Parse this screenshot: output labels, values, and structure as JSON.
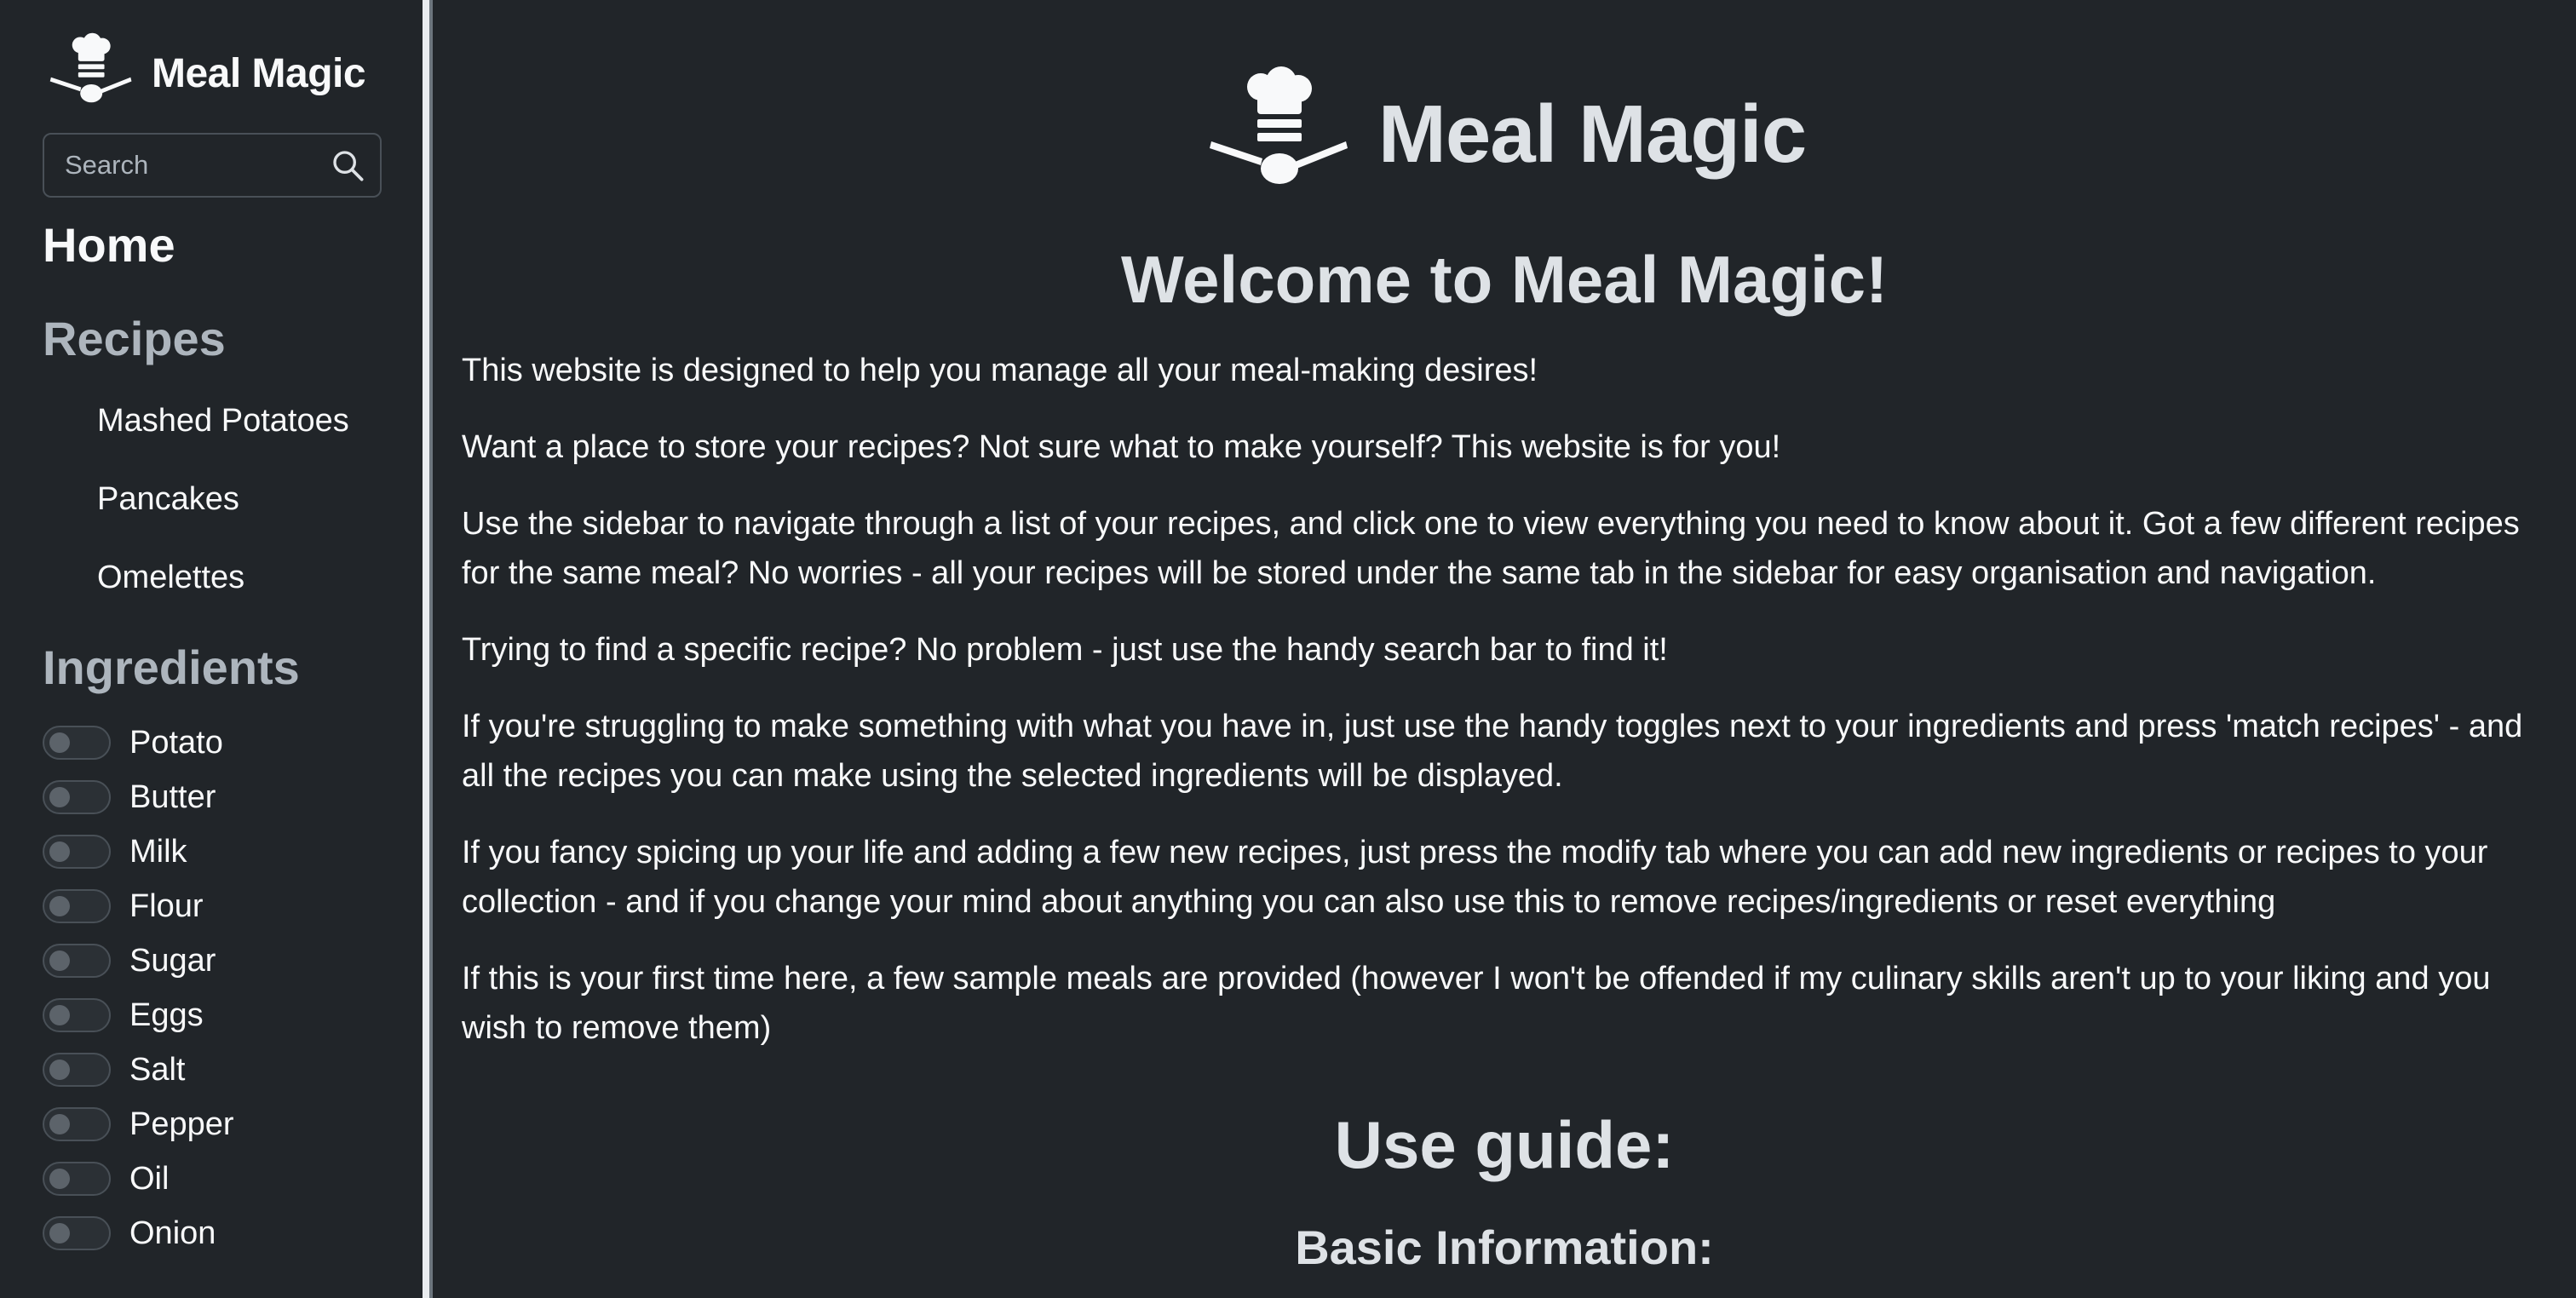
{
  "brand": {
    "name": "Meal Magic"
  },
  "search": {
    "placeholder": "Search"
  },
  "nav": {
    "home": "Home",
    "recipes_heading": "Recipes",
    "recipes": [
      "Mashed Potatoes",
      "Pancakes",
      "Omelettes"
    ],
    "ingredients_heading": "Ingredients",
    "ingredients": [
      "Potato",
      "Butter",
      "Milk",
      "Flour",
      "Sugar",
      "Eggs",
      "Salt",
      "Pepper",
      "Oil",
      "Onion"
    ]
  },
  "main": {
    "hero_name": "Meal Magic",
    "welcome": "Welcome to Meal Magic!",
    "paragraphs": [
      "This website is designed to help you manage all your meal-making desires!",
      "Want a place to store your recipes? Not sure what to make yourself? This website is for you!",
      "Use the sidebar to navigate through a list of your recipes, and click one to view everything you need to know about it. Got a few different recipes for the same meal? No worries - all your recipes will be stored under the same tab in the sidebar for easy organisation and navigation.",
      "Trying to find a specific recipe? No problem - just use the handy search bar to find it!",
      "If you're struggling to make something with what you have in, just use the handy toggles next to your ingredients and press 'match recipes' - and all the recipes you can make using the selected ingredients will be displayed.",
      "If you fancy spicing up your life and adding a few new recipes, just press the modify tab where you can add new ingredients or recipes to your collection - and if you change your mind about anything you can also use this to remove recipes/ingredients or reset everything",
      "If this is your first time here, a few sample meals are provided (however I won't be offended if my culinary skills aren't up to your liking and you wish to remove them)"
    ],
    "use_guide": "Use guide:",
    "basic_info": "Basic Information:"
  },
  "icons": {
    "brand_logo": "chef-hat-spoon-icon",
    "search": "search-icon"
  },
  "colors": {
    "background": "#212529",
    "text": "#dee2e6",
    "muted": "#adb5bd"
  }
}
